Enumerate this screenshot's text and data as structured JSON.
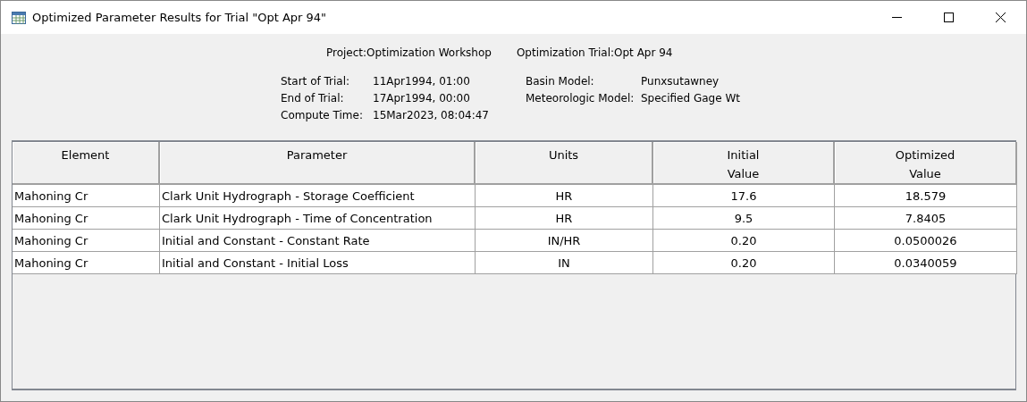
{
  "window": {
    "title": "Optimized Parameter Results for Trial \"Opt Apr 94\""
  },
  "summary": {
    "top": [
      {
        "label": "Project:",
        "value": "Optimization Workshop"
      },
      {
        "label": "Optimization Trial:",
        "value": "Opt Apr 94"
      }
    ],
    "left": [
      {
        "label": "Start of Trial:",
        "value": "11Apr1994, 01:00"
      },
      {
        "label": "End of Trial:",
        "value": "17Apr1994, 00:00"
      },
      {
        "label": "Compute Time:",
        "value": "15Mar2023, 08:04:47"
      }
    ],
    "right": [
      {
        "label": "Basin Model:",
        "value": "Punxsutawney"
      },
      {
        "label": "Meteorologic Model:",
        "value": "Specified Gage Wt"
      }
    ]
  },
  "table": {
    "columns": [
      "Element",
      "Parameter",
      "Units",
      "Initial\nValue",
      "Optimized\nValue"
    ],
    "rows": [
      [
        "Mahoning Cr",
        "Clark Unit Hydrograph - Storage Coefficient",
        "HR",
        "17.6",
        "18.579"
      ],
      [
        "Mahoning Cr",
        "Clark Unit Hydrograph - Time of Concentration",
        "HR",
        "9.5",
        "7.8405"
      ],
      [
        "Mahoning Cr",
        "Initial and Constant - Constant Rate",
        "IN/HR",
        "0.20",
        "0.0500026"
      ],
      [
        "Mahoning Cr",
        "Initial and Constant - Initial Loss",
        "IN",
        "0.20",
        "0.0340059"
      ]
    ]
  }
}
